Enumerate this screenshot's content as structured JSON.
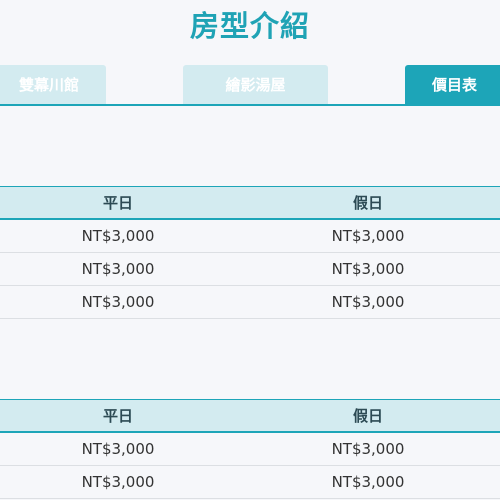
{
  "page": {
    "title": "房型介紹"
  },
  "tabs": [
    {
      "label": "雙幕川館",
      "active": false
    },
    {
      "label": "繪影湯屋",
      "active": false
    },
    {
      "label": "價目表",
      "active": true
    }
  ],
  "colors": {
    "accent": "#1da5b8",
    "tab_inactive": "#d3ebf0",
    "header_bg": "#d3ebf0",
    "background": "#f6f7fa"
  },
  "price_tables": [
    {
      "headers": [
        "平日",
        "假日"
      ],
      "rows": [
        [
          "NT$3,000",
          "NT$3,000"
        ],
        [
          "NT$3,000",
          "NT$3,000"
        ],
        [
          "NT$3,000",
          "NT$3,000"
        ]
      ]
    },
    {
      "headers": [
        "平日",
        "假日"
      ],
      "rows": [
        [
          "NT$3,000",
          "NT$3,000"
        ],
        [
          "NT$3,000",
          "NT$3,000"
        ]
      ]
    }
  ]
}
